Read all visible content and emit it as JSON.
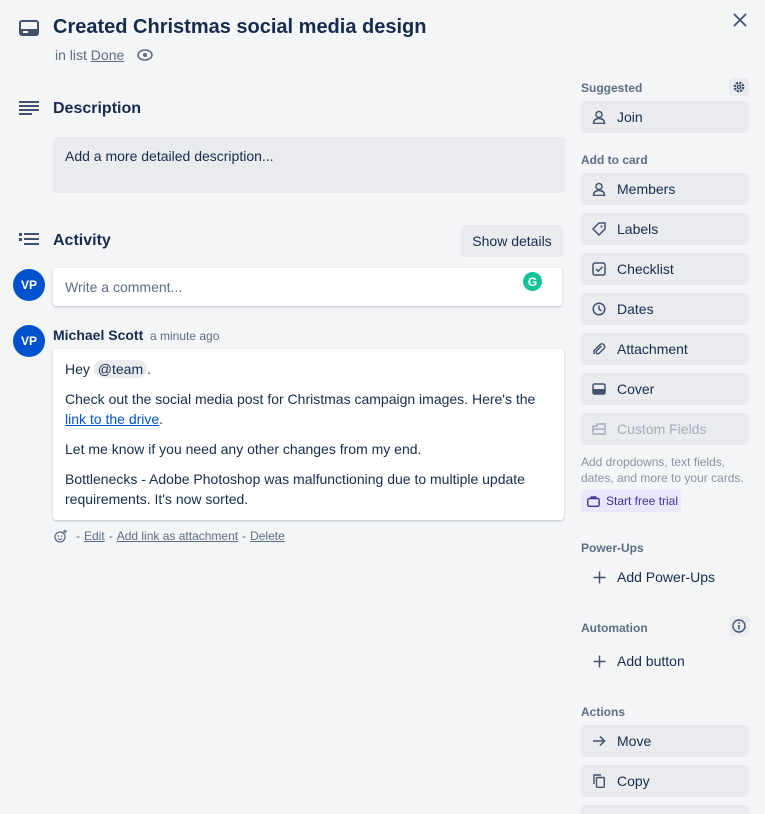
{
  "card": {
    "title": "Created Christmas social media design",
    "list_prefix": "in list",
    "list_name": "Done"
  },
  "description": {
    "heading": "Description",
    "placeholder": "Add a more detailed description..."
  },
  "activity": {
    "heading": "Activity",
    "show_details": "Show details",
    "current_user_initials": "VP",
    "comment_placeholder": "Write a comment...",
    "grammarly_letter": "G"
  },
  "comment": {
    "avatar_initials": "VP",
    "author": "Michael Scott",
    "time": "a minute ago",
    "greeting": "Hey",
    "mention": "@team",
    "greeting_end": ".",
    "para2_text": "Check out the social media post for Christmas campaign images. Here's the",
    "para2_link": "link to the drive",
    "para2_end": ".",
    "para3": "Let me know if you need any other changes from my end.",
    "para4": "Bottlenecks - Adobe Photoshop was malfunctioning due to multiple update requirements. It's now sorted.",
    "sep": "-",
    "edit": "Edit",
    "add_link": "Add link as attachment",
    "delete": "Delete"
  },
  "sidebar": {
    "suggested_heading": "Suggested",
    "join": "Join",
    "add_to_card_heading": "Add to card",
    "members": "Members",
    "labels": "Labels",
    "checklist": "Checklist",
    "dates": "Dates",
    "attachment": "Attachment",
    "cover": "Cover",
    "custom_fields": "Custom Fields",
    "custom_fields_hint": "Add dropdowns, text fields, dates, and more to your cards.",
    "start_trial": "Start free trial",
    "powerups_heading": "Power-Ups",
    "add_powerups": "Add Power-Ups",
    "automation_heading": "Automation",
    "add_button": "Add button",
    "actions_heading": "Actions",
    "move": "Move",
    "copy": "Copy"
  },
  "colors": {
    "background": "#f4f5f7",
    "avatar": "#0052cc",
    "link": "#0052cc",
    "button_bg": "#e9ebee",
    "grammarly": "#15c39a",
    "trial_bg": "#eae6ff"
  }
}
